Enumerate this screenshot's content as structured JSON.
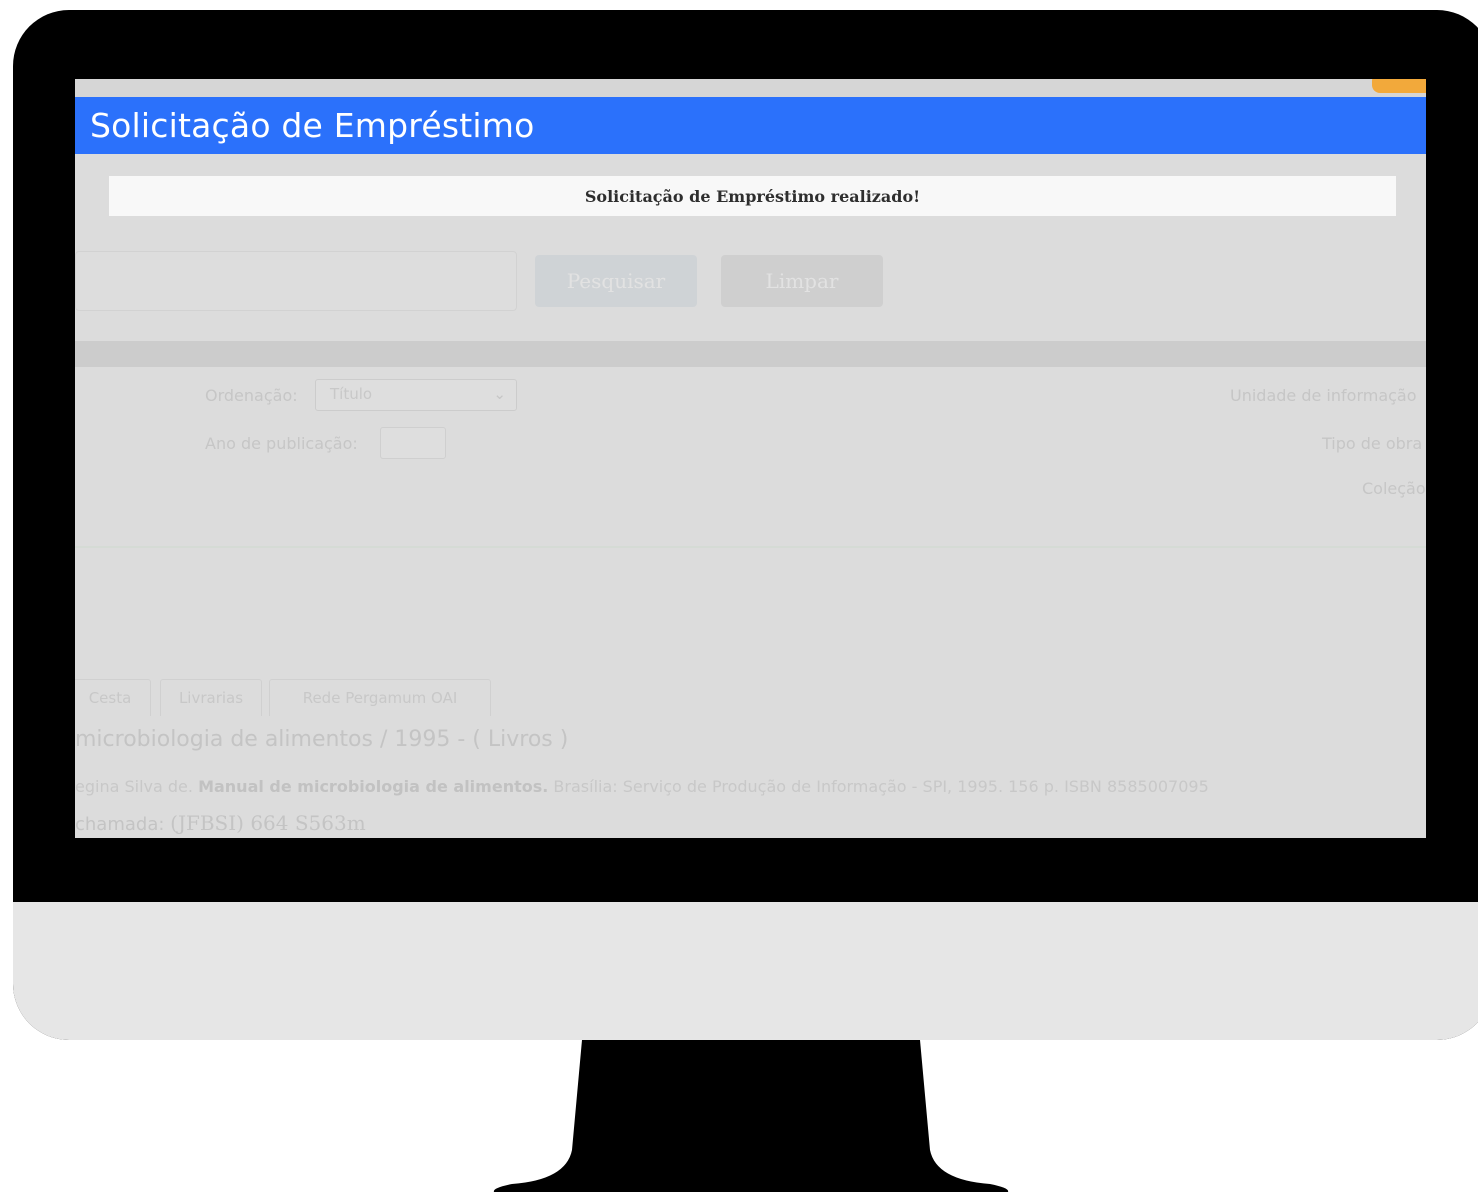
{
  "modal": {
    "title": "Solicitação de Empréstimo",
    "message": "Solicitação de Empréstimo realizado!"
  },
  "background": {
    "buttons": {
      "search": "Pesquisar",
      "clear": "Limpar"
    },
    "filters": {
      "ordering_label": "Ordenação:",
      "ordering_value": "Título",
      "year_label": "Ano de publicação:",
      "unit_label": "Unidade de informação",
      "type_label": "Tipo de obra",
      "collection_label": "Coleção"
    },
    "tabs": [
      "Cesta",
      "Livrarias",
      "Rede Pergamum OAI"
    ],
    "result": {
      "title": "microbiologia de alimentos / 1995 - ( Livros )",
      "ref_prefix": "egina Silva de.",
      "ref_bold": "Manual de microbiologia de alimentos.",
      "ref_rest": "Brasília: Serviço de Produção de Informação - SPI, 1995. 156 p. ISBN 8585007095",
      "call_label": "chamada:",
      "call_value": "(JFBSI) 664 S563m"
    }
  },
  "colors": {
    "header_blue": "#2b71fb",
    "monitor_frame": "#000000",
    "monitor_chin": "#e6e6e6",
    "accent_orange": "#f2a93b"
  }
}
